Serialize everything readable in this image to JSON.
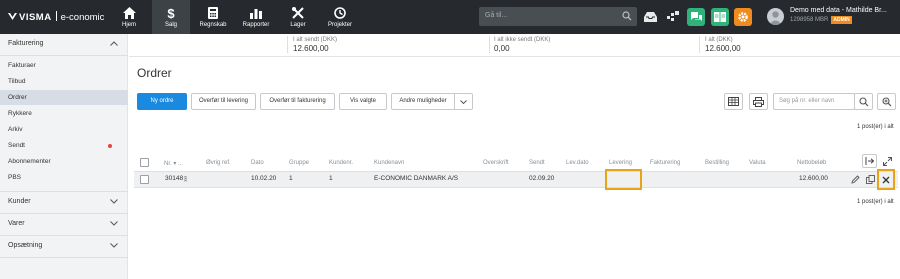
{
  "topbar": {
    "logo_brand": "VISMA",
    "logo_product": "e-conomic",
    "nav": [
      {
        "label": "Hjem",
        "icon": "home-icon"
      },
      {
        "label": "Salg",
        "icon": "dollar-icon",
        "active": true
      },
      {
        "label": "Regnskab",
        "icon": "calculator-icon"
      },
      {
        "label": "Rapporter",
        "icon": "bar-chart-icon"
      },
      {
        "label": "Lager",
        "icon": "tools-icon"
      },
      {
        "label": "Projekter",
        "icon": "clock-icon"
      }
    ],
    "search_placeholder": "Gå til...",
    "user_name": "Demo med data - Mathilde Br...",
    "user_id": "1298958 MBR",
    "user_role": "ADMIN",
    "colors": {
      "bar": "#262a2e",
      "green": "#2fb37a",
      "orange": "#f08b1d"
    }
  },
  "sidebar": {
    "section_fakturering": "Fakturering",
    "items": [
      {
        "label": "Fakturaer"
      },
      {
        "label": "Tilbud"
      },
      {
        "label": "Ordrer",
        "active": true
      },
      {
        "label": "Rykkere"
      },
      {
        "label": "Arkiv"
      },
      {
        "label": "Sendt",
        "dot": true
      },
      {
        "label": "Abonnementer"
      },
      {
        "label": "PBS"
      }
    ],
    "section_kunder": "Kunder",
    "section_varer": "Varer",
    "section_opsaetning": "Opsætning"
  },
  "summary": [
    {
      "label": "I alt sendt (DKK)",
      "value": "12.600,00"
    },
    {
      "label": "I alt ikke sendt (DKK)",
      "value": "0,00"
    },
    {
      "label": "I alt (DKK)",
      "value": "12.600,00"
    }
  ],
  "page_title": "Ordrer",
  "toolbar": {
    "new_order": "Ny ordre",
    "transfer_delivery": "Overfør til levering",
    "transfer_invoice": "Overfør til fakturering",
    "show_selected": "Vis valgte",
    "more_options": "Andre muligheder",
    "search_placeholder": "Søg på nr. eller navn"
  },
  "count_top": "1 post(er) i alt",
  "count_bottom": "1 post(er) i alt",
  "table": {
    "headers": {
      "nr": "Nr. ▾ ...",
      "ref": "Øvrig ref.",
      "dato": "Dato",
      "gruppe": "Gruppe",
      "kunde": "Kundenr.",
      "navn": "Kundenavn",
      "overskrift": "Overskrift",
      "sendt": "Sendt",
      "levdato": "Lev.dato",
      "levering": "Levering",
      "fakturering": "Fakturering",
      "bestilling": "Bestilling",
      "valuta": "Valuta",
      "netto": "Nettobeløb"
    },
    "row": {
      "nr": "30148",
      "dato": "10.02.20",
      "gruppe": "1",
      "kunde": "1",
      "navn": "E-CONOMIC DANMARK A/S",
      "sendt": "02.09.20",
      "netto": "12.600,00"
    }
  }
}
